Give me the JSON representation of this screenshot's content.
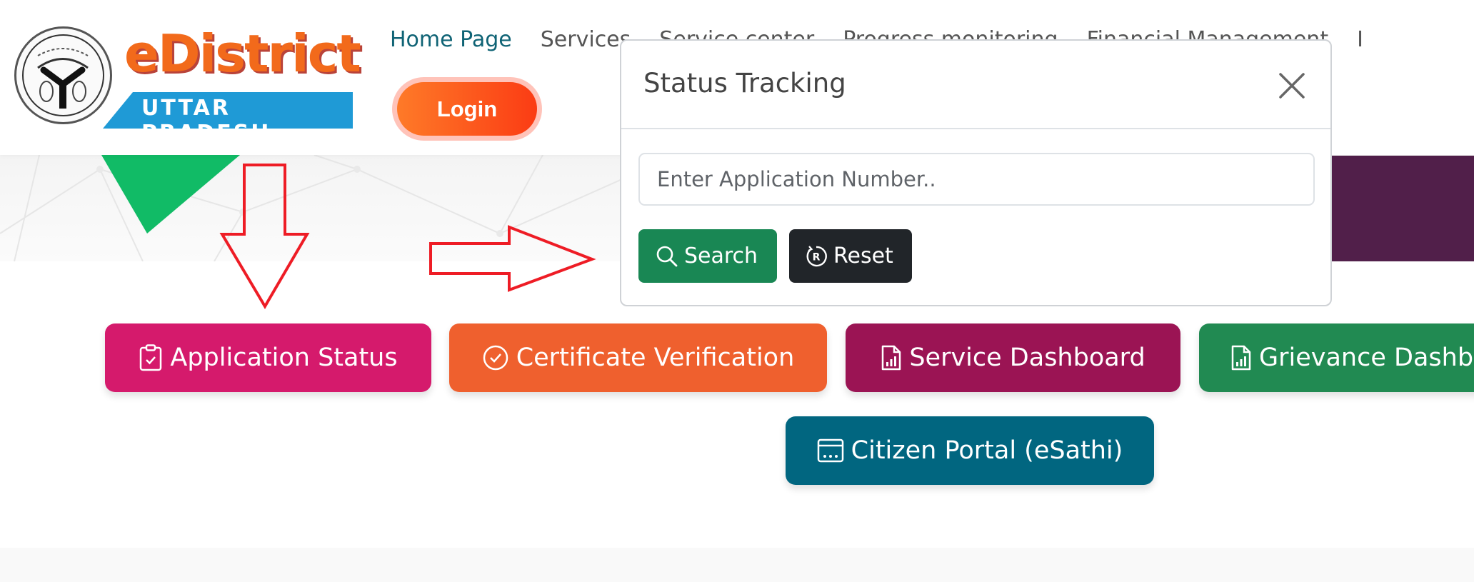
{
  "header": {
    "logo": {
      "brand": "eDistrict",
      "state": "UTTAR PRADESH",
      "emblem_icon": "up-government-emblem"
    },
    "nav": {
      "items": [
        {
          "label": "Home Page",
          "active": true
        },
        {
          "label": "Services",
          "active": false
        },
        {
          "label": "Service center",
          "active": false
        },
        {
          "label": "Progress monitoring",
          "active": false
        },
        {
          "label": "Financial Management",
          "active": false
        },
        {
          "label": "I",
          "active": false
        }
      ]
    },
    "login_label": "Login"
  },
  "modal": {
    "title": "Status Tracking",
    "close_icon": "close-icon",
    "input": {
      "value": "",
      "placeholder": "Enter Application Number.."
    },
    "search_label": "Search",
    "reset_label": "Reset"
  },
  "actions": [
    {
      "label": "Application Status",
      "icon": "clipboard-check-icon",
      "color": "#d51a6c"
    },
    {
      "label": "Certificate Verification",
      "icon": "check-circle-icon",
      "color": "#ef602e"
    },
    {
      "label": "Service Dashboard",
      "icon": "file-bar-chart-icon",
      "color": "#9b1454"
    },
    {
      "label": "Grievance Dashboard",
      "icon": "file-bar-chart-icon",
      "color": "#218a52"
    },
    {
      "label": "Citizen Portal (eSathi)",
      "icon": "browser-window-icon",
      "color": "#016680"
    }
  ],
  "annotations": {
    "arrow_color": "#ee1c25",
    "arrows": [
      "down-arrow-to-application-status",
      "right-arrow-to-status-tracking"
    ]
  },
  "colors": {
    "nav_active": "#0f6375",
    "brand_orange": "#f26a1b",
    "search_green": "#198754",
    "reset_dark": "#212529"
  }
}
